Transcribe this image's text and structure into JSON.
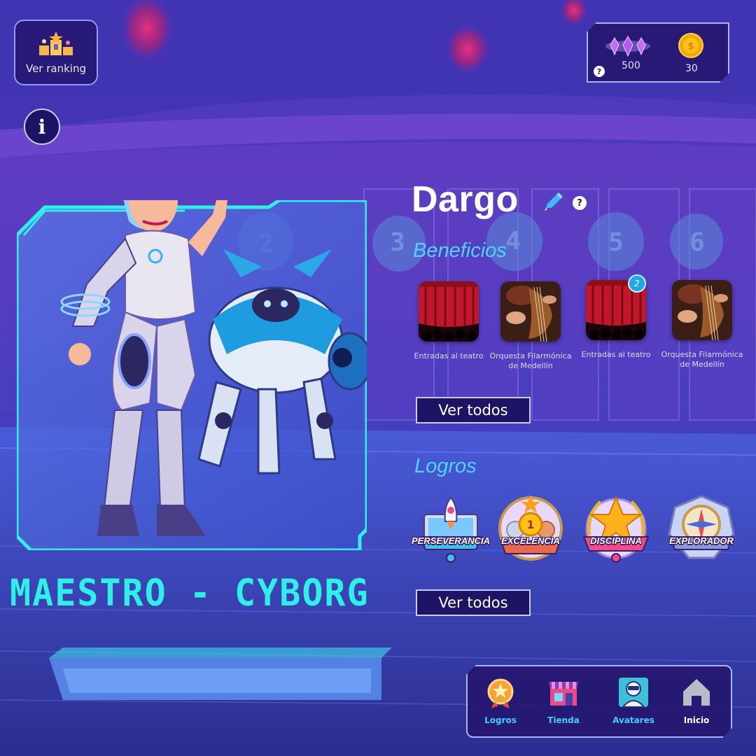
{
  "ranking": {
    "label": "Ver ranking"
  },
  "info": {
    "glyph": "i"
  },
  "currency": {
    "gems": "500",
    "coins": "30",
    "help_glyph": "?"
  },
  "profile": {
    "name": "Dargo",
    "help_glyph": "?"
  },
  "avatar": {
    "rank_title": "MAESTRO - CYBORG",
    "background_hall_numbers": [
      "2",
      "3",
      "4",
      "5",
      "6"
    ]
  },
  "benefits": {
    "title": "Beneficios",
    "items": [
      {
        "caption": "Entradas al teatro",
        "image": "theater-curtain"
      },
      {
        "caption": "Orquesta Filarmónica de Medellín",
        "image": "violin"
      },
      {
        "caption": "Entradas al teatro",
        "image": "theater-curtain",
        "count": "2"
      },
      {
        "caption": "Orquesta Filarmónica de Medellín",
        "image": "violin"
      }
    ],
    "view_all": "Ver todos"
  },
  "achievements": {
    "title": "Logros",
    "items": [
      {
        "label": "PERSEVERANCIA",
        "icon": "rocket-laptop-badge"
      },
      {
        "label": "EXCELENCIA",
        "icon": "podium-medal-badge"
      },
      {
        "label": "DISCIPLINA",
        "icon": "star-laurel-badge"
      },
      {
        "label": "EXPLORADOR",
        "icon": "compass-badge"
      }
    ],
    "view_all": "Ver todos"
  },
  "nav": {
    "items": [
      {
        "label": "Logros",
        "icon": "medal-icon",
        "color": "#3fd0ff"
      },
      {
        "label": "Tienda",
        "icon": "store-icon",
        "color": "#3fd0ff"
      },
      {
        "label": "Avatares",
        "icon": "avatar-icon",
        "color": "#3fd0ff"
      },
      {
        "label": "Inicio",
        "icon": "home-icon",
        "color": "#ffffff"
      }
    ]
  },
  "colors": {
    "accent_cyan": "#2ff0e8",
    "title_blue": "#46d8ff",
    "panel_bg": "#24166e",
    "panel_border": "#a9b4ff"
  }
}
